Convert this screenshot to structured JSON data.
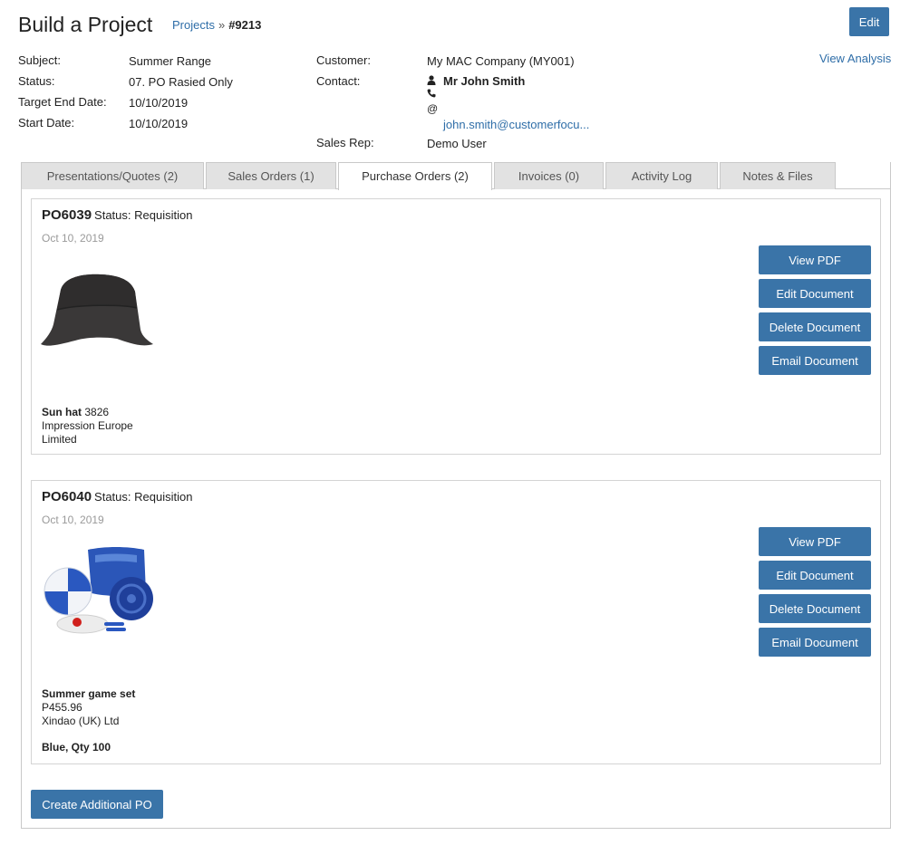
{
  "header": {
    "title": "Build a Project",
    "breadcrumb_link": "Projects",
    "breadcrumb_sep": "»",
    "project_number": "#9213",
    "edit_label": "Edit",
    "view_analysis": "View Analysis"
  },
  "details": {
    "subject_label": "Subject:",
    "subject": "Summer Range",
    "status_label": "Status:",
    "status": "07. PO Rasied Only",
    "target_end_label": "Target End Date:",
    "target_end": "10/10/2019",
    "start_label": "Start Date:",
    "start": "10/10/2019",
    "customer_label": "Customer:",
    "customer": "My MAC Company (MY001)",
    "contact_label": "Contact:",
    "contact_name": "Mr John Smith",
    "contact_email": "john.smith@customerfocu...",
    "sales_rep_label": "Sales Rep:",
    "sales_rep": "Demo User"
  },
  "tabs": [
    {
      "label": "Presentations/Quotes (2)"
    },
    {
      "label": "Sales Orders (1)"
    },
    {
      "label": "Purchase Orders (2)"
    },
    {
      "label": "Invoices (0)"
    },
    {
      "label": "Activity Log"
    },
    {
      "label": "Notes & Files"
    }
  ],
  "active_tab": "Purchase Orders (2)",
  "actions": {
    "view_pdf": "View PDF",
    "edit_document": "Edit Document",
    "delete_document": "Delete Document",
    "email_document": "Email Document"
  },
  "purchase_orders": [
    {
      "number": "PO6039",
      "status": "Status: Requisition",
      "date": "Oct 10, 2019",
      "item_name": "Sun hat",
      "item_code": "3826",
      "supplier_line1": "Impression Europe",
      "supplier_line2": "Limited"
    },
    {
      "number": "PO6040",
      "status": "Status: Requisition",
      "date": "Oct 10, 2019",
      "item_name": "Summer game set",
      "item_code": "P455.96",
      "supplier_line1": "Xindao (UK) Ltd",
      "variant": "Blue, Qty 100"
    }
  ],
  "create_po_label": "Create Additional PO",
  "colors": {
    "primary_button": "#3a74a8",
    "link": "#2f6ea8",
    "tab_inactive": "#e2e2e2",
    "muted_text": "#9a9a9a"
  }
}
